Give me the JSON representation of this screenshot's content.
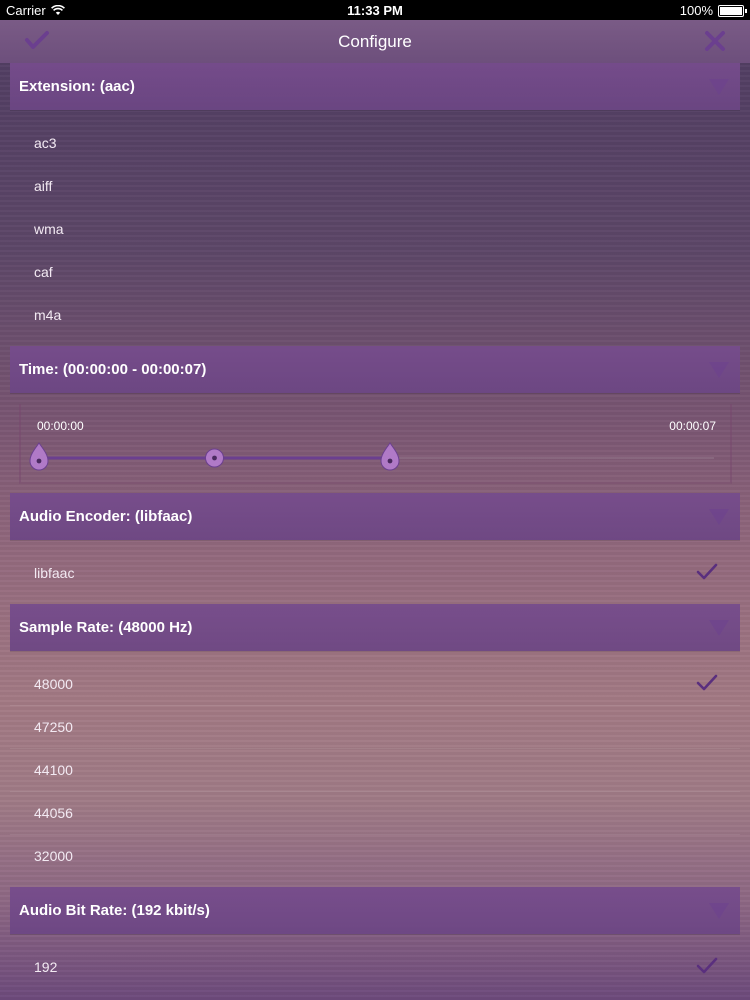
{
  "status_bar": {
    "carrier": "Carrier",
    "time": "11:33 PM",
    "battery": "100%"
  },
  "nav": {
    "title": "Configure",
    "confirm_icon": "checkmark-icon",
    "close_icon": "close-icon"
  },
  "sections": {
    "extension": {
      "label": "Extension: (aac)",
      "options": [
        "ac3",
        "aiff",
        "wma",
        "caf",
        "m4a"
      ]
    },
    "time": {
      "label": "Time: (00:00:00 - 00:00:07)",
      "start_label": "00:00:00",
      "end_label": "00:00:07",
      "range_start_fraction": 0.0,
      "range_end_fraction": 0.52,
      "playhead_fraction": 0.26
    },
    "audio_encoder": {
      "label": "Audio Encoder: (libfaac)",
      "options": [
        "libfaac"
      ],
      "selected": "libfaac"
    },
    "sample_rate": {
      "label": "Sample Rate: (48000 Hz)",
      "options": [
        "48000",
        "47250",
        "44100",
        "44056",
        "32000"
      ],
      "selected": "48000"
    },
    "audio_bit_rate": {
      "label": "Audio Bit Rate: (192 kbit/s)",
      "options": [
        "192"
      ],
      "selected": "192"
    }
  },
  "colors": {
    "accent": "#6b3f8f",
    "handle": "#b07ac7",
    "header": "#744c8c"
  }
}
